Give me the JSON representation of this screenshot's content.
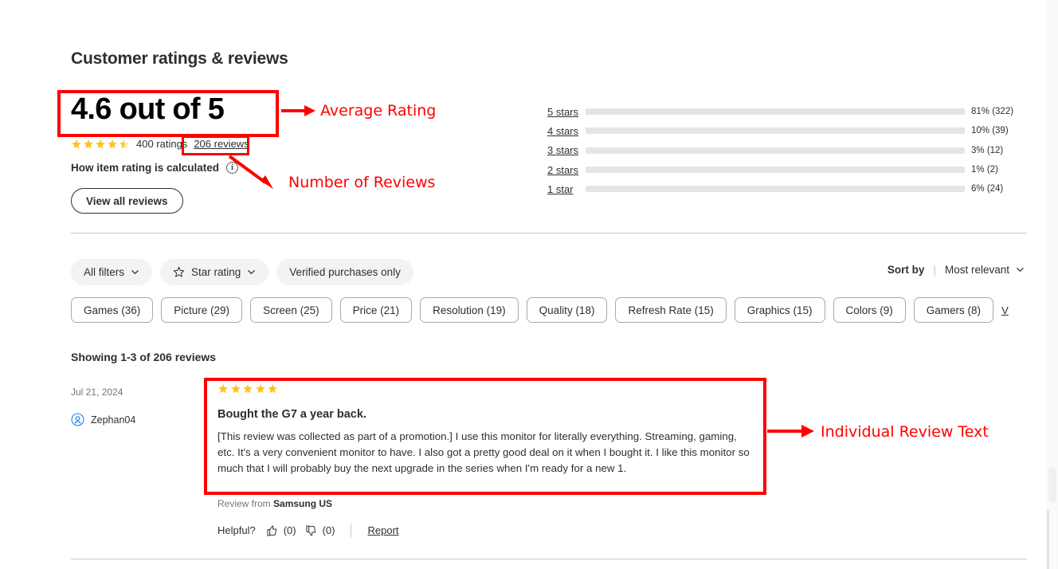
{
  "section": {
    "title": "Customer ratings & reviews"
  },
  "summary": {
    "average_text": "4.6 out of 5",
    "average_value": 4.6,
    "star_fill": 4.5,
    "ratings_count_text": "400 ratings",
    "reviews_link_text": "206 reviews",
    "how_calculated_label": "How item rating is calculated",
    "info_glyph": "i",
    "view_all_label": "View all reviews"
  },
  "chart_data": {
    "type": "bar",
    "title": "Rating distribution",
    "orientation": "horizontal",
    "categories": [
      "5 stars",
      "4 stars",
      "3 stars",
      "2 stars",
      "1 star"
    ],
    "values": [
      81,
      10,
      3,
      1,
      6
    ],
    "counts": [
      322,
      39,
      12,
      2,
      24
    ],
    "value_labels": [
      "81% (322)",
      "10% (39)",
      "3% (12)",
      "1% (2)",
      "6% (24)"
    ],
    "xlabel": "",
    "ylabel": "",
    "xlim": [
      0,
      100
    ],
    "grid": false,
    "legend": "none",
    "bar_color": "#0071dc",
    "track_color": "#e4e5e7"
  },
  "filters": {
    "all_filters_label": "All filters",
    "star_rating_label": "Star rating",
    "verified_label": "Verified purchases only",
    "chevron_icon": "chevron-down-icon",
    "star_icon": "star-outline-icon"
  },
  "sort": {
    "label": "Sort by",
    "separator": "|",
    "value": "Most relevant",
    "chevron_icon": "chevron-down-icon"
  },
  "tags": [
    {
      "label": "Games (36)"
    },
    {
      "label": "Picture (29)"
    },
    {
      "label": "Screen (25)"
    },
    {
      "label": "Price (21)"
    },
    {
      "label": "Resolution (19)"
    },
    {
      "label": "Quality (18)"
    },
    {
      "label": "Refresh Rate (15)"
    },
    {
      "label": "Graphics (15)"
    },
    {
      "label": "Colors (9)"
    },
    {
      "label": "Gamers (8)"
    }
  ],
  "tags_more_label": "V",
  "results": {
    "showing_text": "Showing 1-3 of 206 reviews"
  },
  "review": {
    "date": "Jul 21, 2024",
    "author": "Zephan04",
    "avatar_icon": "user-avatar-icon",
    "stars": 5,
    "title": "Bought the G7 a year back.",
    "text": "[This review was collected as part of a promotion.] I use this monitor for literally everything. Streaming, gaming, etc. It's a very convenient monitor to have. I also got a pretty good deal on it when I bought it. I like this monitor so much that I will probably buy the next upgrade in the series when I'm ready for a new 1.",
    "source_prefix": "Review from ",
    "source_name": "Samsung US",
    "helpful_label": "Helpful?",
    "thumbs_up_count": "(0)",
    "thumbs_down_count": "(0)",
    "report_label": "Report",
    "thumbs_up_icon": "thumbs-up-icon",
    "thumbs_down_icon": "thumbs-down-icon"
  },
  "annotations": {
    "color": "#ff0000",
    "average_rating": "Average Rating",
    "number_of_reviews": "Number of Reviews",
    "individual_review_text": "Individual Review Text"
  }
}
